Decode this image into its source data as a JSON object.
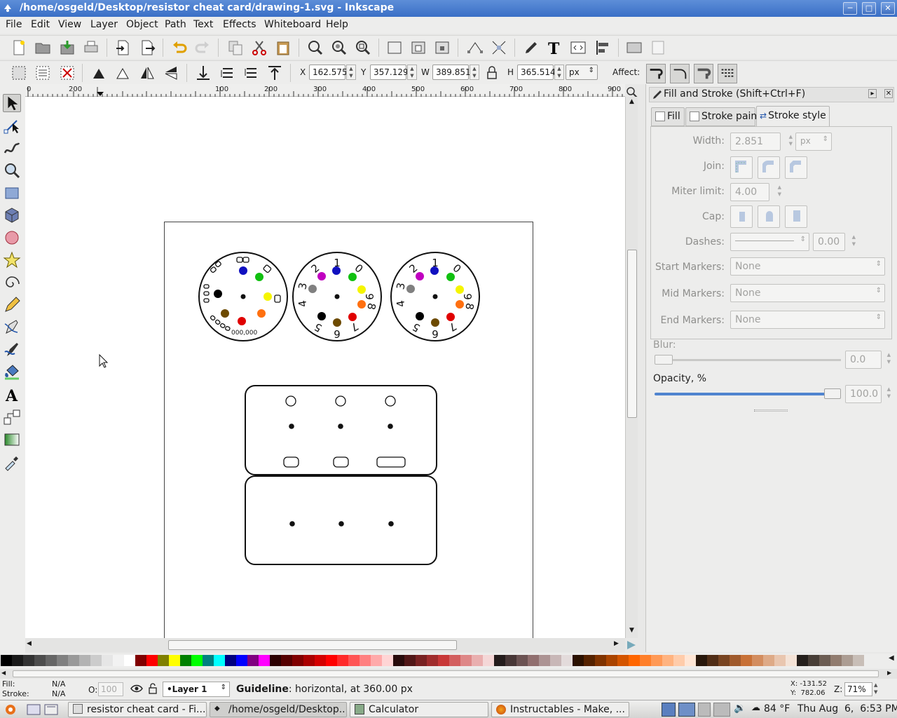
{
  "window": {
    "title": "/home/osgeld/Desktop/resistor cheat card/drawing-1.svg - Inkscape"
  },
  "menu": [
    "File",
    "Edit",
    "View",
    "Layer",
    "Object",
    "Path",
    "Text",
    "Effects",
    "Whiteboard",
    "Help"
  ],
  "coords": {
    "x_label": "X",
    "x": "162.575",
    "y_label": "Y",
    "y": "357.129",
    "w_label": "W",
    "w": "389.851",
    "h_label": "H",
    "h": "365.514",
    "unit": "px",
    "affect_label": "Affect:"
  },
  "ruler_ticks": [
    "0",
    "200",
    "100",
    "200",
    "300",
    "400",
    "500",
    "600",
    "700",
    "800",
    "900"
  ],
  "panel": {
    "title": "Fill and Stroke (Shift+Ctrl+F)",
    "tabs": [
      "Fill",
      "Stroke paint",
      "Stroke style"
    ],
    "width_label": "Width:",
    "width_value": "2.851",
    "width_unit": "px",
    "join_label": "Join:",
    "miter_label": "Miter limit:",
    "miter_value": "4.00",
    "cap_label": "Cap:",
    "dashes_label": "Dashes:",
    "dashes_value": "0.00",
    "start_markers_label": "Start Markers:",
    "start_markers": "None",
    "mid_markers_label": "Mid Markers:",
    "mid_markers": "None",
    "end_markers_label": "End Markers:",
    "end_markers": "None",
    "blur_label": "Blur:",
    "blur_value": "0.0",
    "opacity_label": "Opacity, %",
    "opacity_value": "100.0"
  },
  "status": {
    "fill_label": "Fill:",
    "fill_value": "N/A",
    "stroke_label": "Stroke:",
    "stroke_value": "N/A",
    "o_label": "O:",
    "o_value": "100",
    "layer": "•Layer 1",
    "message_bold": "Guideline",
    "message": ": horizontal, at 360.00 px",
    "cursor_x": "X: -131.52",
    "cursor_y": "Y:  782.06",
    "zoom_label": "Z:",
    "zoom": "71%"
  },
  "taskbar": {
    "tasks": [
      "resistor cheat card - Fi...",
      "/home/osgeld/Desktop...",
      "Calculator",
      "Instructables - Make, ..."
    ],
    "weather": "84 °F",
    "clock": "Thu Aug  6,  6:53 PM"
  },
  "palette_colors": [
    "#000000",
    "#1a1a1a",
    "#333333",
    "#4d4d4d",
    "#666666",
    "#808080",
    "#999999",
    "#b3b3b3",
    "#cccccc",
    "#e6e6e6",
    "#f2f2f2",
    "#ffffff",
    "#800000",
    "#ff0000",
    "#808000",
    "#ffff00",
    "#008000",
    "#00ff00",
    "#008080",
    "#00ffff",
    "#000080",
    "#0000ff",
    "#800080",
    "#ff00ff",
    "#2b0000",
    "#550000",
    "#800000",
    "#aa0000",
    "#d40000",
    "#ff0000",
    "#ff2a2a",
    "#ff5555",
    "#ff8080",
    "#ffaaaa",
    "#ffd5d5",
    "#280b0b",
    "#501616",
    "#782121",
    "#a02c2c",
    "#c83737",
    "#d35f5f",
    "#de8787",
    "#e9afaf",
    "#f4d7d7",
    "#241c1c",
    "#483737",
    "#6c5353",
    "#916f6f",
    "#ac9393",
    "#c8b7b7",
    "#e3dbdb",
    "#2b1100",
    "#552200",
    "#803300",
    "#aa4400",
    "#d45500",
    "#ff6600",
    "#ff7f2a",
    "#ff9955",
    "#ffb380",
    "#ffccaa",
    "#ffe6d5",
    "#28170b",
    "#502d16",
    "#784421",
    "#a05a2c",
    "#c87137",
    "#d38d5f",
    "#deaa87",
    "#e9c6af",
    "#f4e3d7",
    "#241f1c",
    "#483e37",
    "#6c5d53",
    "#917c6f",
    "#ac9d93",
    "#c8beb7"
  ],
  "colors": {
    "wheel_colors": [
      "#000000",
      "#7a4f00",
      "#ff0000",
      "#ff7f00",
      "#ffff00",
      "#00c000",
      "#0000c0",
      "#c000c0",
      "#808080",
      "#ffffff"
    ]
  }
}
